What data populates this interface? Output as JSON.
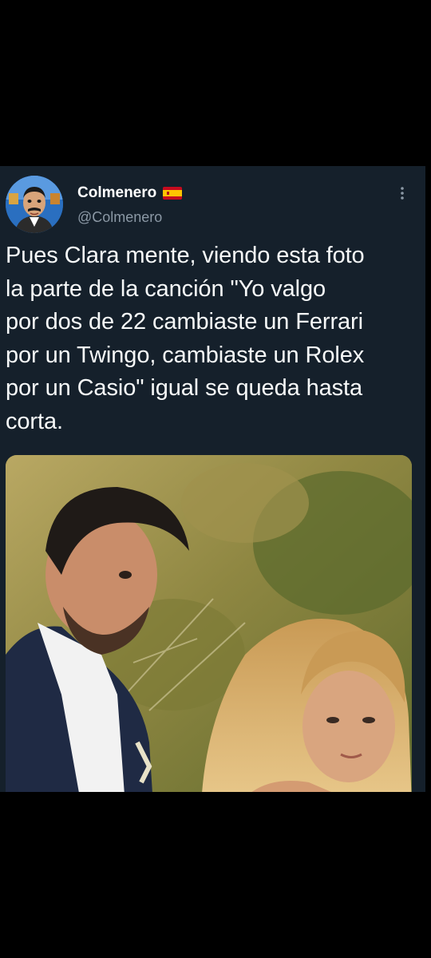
{
  "tweet": {
    "display_name": "Colmenero",
    "handle": "@Colmenero",
    "text": "Pues Clara mente, viendo esta foto\nla parte de la canción \"Yo valgo\npor dos de 22 cambiaste un Ferrari\npor un Twingo, cambiaste un Rolex\npor un Casio\" igual se queda hasta\ncorta.",
    "flag_icon": "spain-flag-icon",
    "more_icon": "vertical-ellipsis-icon"
  },
  "colors": {
    "screen_background": "#000000",
    "tweet_background": "#15202b",
    "text_primary": "#f7f9f9",
    "text_secondary": "#8b98a5"
  }
}
